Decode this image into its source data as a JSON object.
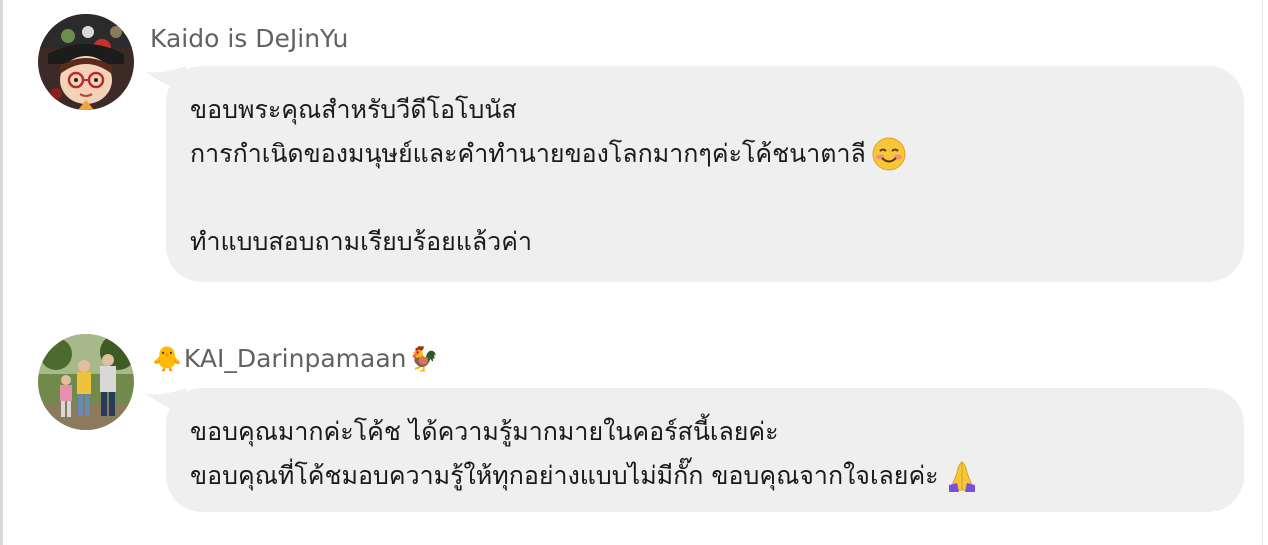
{
  "colors": {
    "bubble_bg": "#efefef",
    "author_text": "#626262",
    "message_text": "#1a1a1a",
    "left_rule": "#d8d8d8"
  },
  "comments": [
    {
      "author": "Kaido is DeJinYu",
      "avatar_icon": "cartoon-girl-avatar-icon",
      "lines": [
        "ขอบพระคุณสำหรับวีดีโอโบนัส",
        "การกำเนิดของมนุษย์และคำทำนายของโลกมากๆค่ะโค้ชนาตาลี",
        "",
        "ทำแบบสอบถามเรียบร้อยแล้วค่า"
      ],
      "emoji_line2": "smiling-face-emoji"
    },
    {
      "author_prefix_emoji": "🐥",
      "author": "KAI_Darinpamaan",
      "author_suffix_emoji": "🐓",
      "avatar_icon": "family-photo-avatar-icon",
      "lines": [
        "ขอบคุณมากค่ะโค้ช ได้ความรู้มากมายในคอร์สนี้เลยค่ะ",
        "ขอบคุณที่โค้ชมอบความรู้ให้ทุกอย่างแบบไม่มีกั๊ก ขอบคุณจากใจเลยค่ะ"
      ],
      "emoji_line2": "folded-hands-emoji"
    }
  ]
}
